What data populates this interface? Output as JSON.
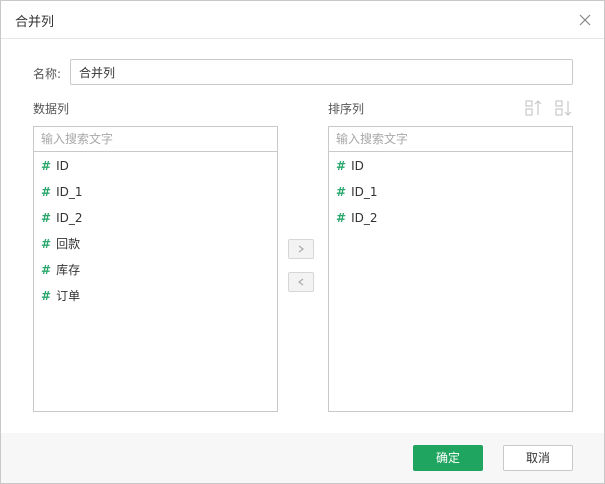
{
  "dialog": {
    "title": "合并列",
    "close_icon": "close-icon"
  },
  "name_field": {
    "label": "名称:",
    "value": "合并列"
  },
  "data_columns": {
    "label": "数据列",
    "search_placeholder": "输入搜索文字",
    "items": [
      {
        "prefix": "#",
        "label": "ID"
      },
      {
        "prefix": "#",
        "label": "ID_1"
      },
      {
        "prefix": "#",
        "label": "ID_2"
      },
      {
        "prefix": "#",
        "label": "回款"
      },
      {
        "prefix": "#",
        "label": "库存"
      },
      {
        "prefix": "#",
        "label": "订单"
      }
    ]
  },
  "sort_columns": {
    "label": "排序列",
    "search_placeholder": "输入搜索文字",
    "sort_icons": [
      "sort-ascending-icon",
      "sort-descending-icon"
    ],
    "items": [
      {
        "prefix": "#",
        "label": "ID"
      },
      {
        "prefix": "#",
        "label": "ID_1"
      },
      {
        "prefix": "#",
        "label": "ID_2"
      }
    ]
  },
  "transfer": {
    "move_right_icon": "chevron-right-icon",
    "move_left_icon": "chevron-left-icon"
  },
  "footer": {
    "ok_label": "确定",
    "cancel_label": "取消"
  },
  "colors": {
    "accent": "#1fa55f",
    "hash": "#2aa76d"
  }
}
